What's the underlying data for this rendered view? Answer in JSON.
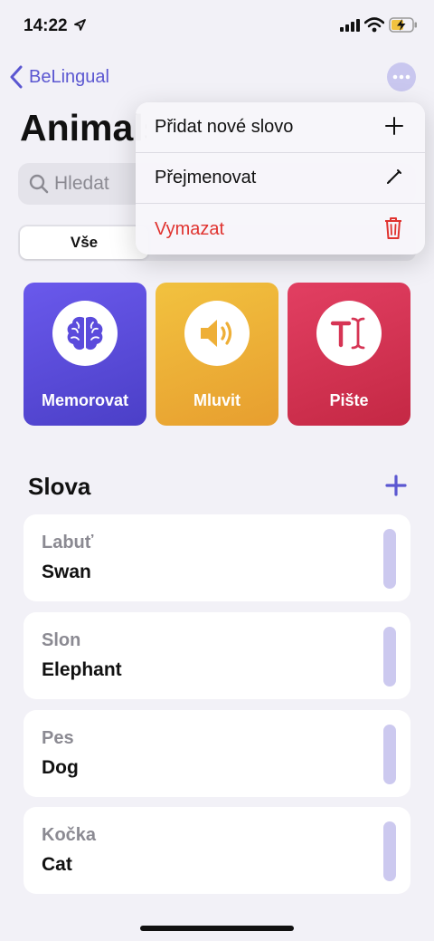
{
  "status": {
    "time": "14:22"
  },
  "nav": {
    "back_label": "BeLingual"
  },
  "page": {
    "title": "Animals"
  },
  "search": {
    "placeholder": "Hledat"
  },
  "segment": {
    "active_label": "Vše"
  },
  "modes": [
    {
      "label": "Memorovat",
      "icon": "brain-icon",
      "color": "#5b4bdc"
    },
    {
      "label": "Mluvit",
      "icon": "speaker-icon",
      "color": "#eeaf37"
    },
    {
      "label": "Pište",
      "icon": "text-cursor-icon",
      "color": "#d63454"
    }
  ],
  "words_section": {
    "title": "Slova"
  },
  "words": [
    {
      "native": "Labuť",
      "foreign": "Swan"
    },
    {
      "native": "Slon",
      "foreign": "Elephant"
    },
    {
      "native": "Pes",
      "foreign": "Dog"
    },
    {
      "native": "Kočka",
      "foreign": "Cat"
    }
  ],
  "menu": {
    "items": [
      {
        "label": "Přidat nové slovo",
        "icon": "plus-icon"
      },
      {
        "label": "Přejmenovat",
        "icon": "pencil-icon"
      },
      {
        "label": "Vymazat",
        "icon": "trash-icon",
        "color": "#e0332f"
      }
    ]
  },
  "colors": {
    "accent": "#5b57d1",
    "background": "#f2f1f7",
    "destructive": "#e0332f"
  }
}
